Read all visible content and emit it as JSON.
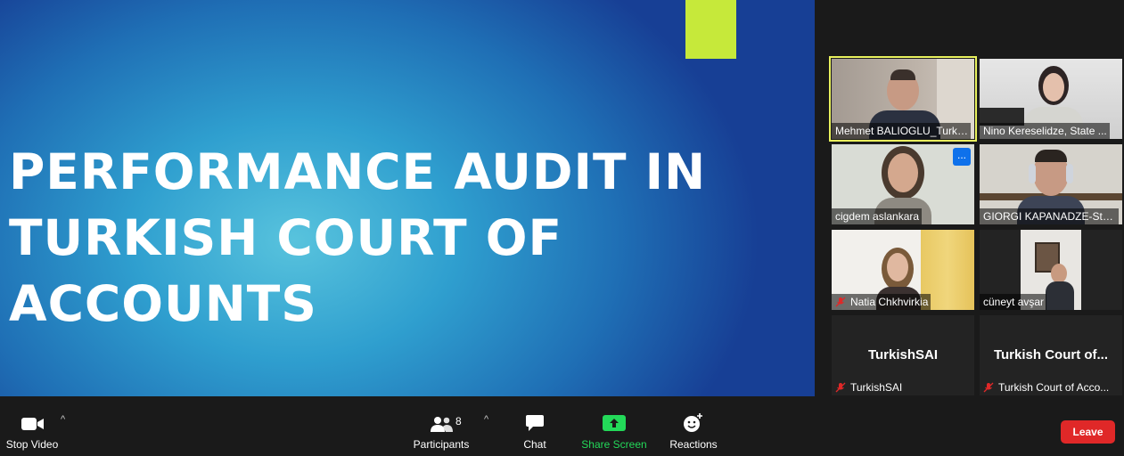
{
  "slide": {
    "title": "PERFORMANCE AUDIT IN\nTURKISH COURT OF\nACCOUNTS",
    "accent_color": "#c6e93a"
  },
  "participants": [
    {
      "name": "Mehmet BALIOGLU_Turki...",
      "muted": false,
      "active_speaker": true
    },
    {
      "name": "Nino Kereselidze, State ...",
      "muted": false
    },
    {
      "name": "cigdem aslankara",
      "muted": false,
      "more_button": "..."
    },
    {
      "name": "GIORGI KAPANADZE-Stat...",
      "muted": false
    },
    {
      "name": "Natia Chkhvirkia",
      "muted": true
    },
    {
      "name": "cüneyt avşar",
      "muted": false
    },
    {
      "name": "TurkishSAI",
      "display": "TurkishSAI",
      "muted": true
    },
    {
      "name": "Turkish Court of Acco...",
      "display": "Turkish Court of...",
      "muted": true
    }
  ],
  "toolbar": {
    "stop_video": "Stop Video",
    "participants": "Participants",
    "participants_count": "8",
    "chat": "Chat",
    "share_screen": "Share Screen",
    "reactions": "Reactions",
    "leave": "Leave"
  },
  "colors": {
    "active_speaker": "#e9f25d",
    "share_screen": "#23d959",
    "leave": "#e02828",
    "more": "#0e71eb"
  }
}
